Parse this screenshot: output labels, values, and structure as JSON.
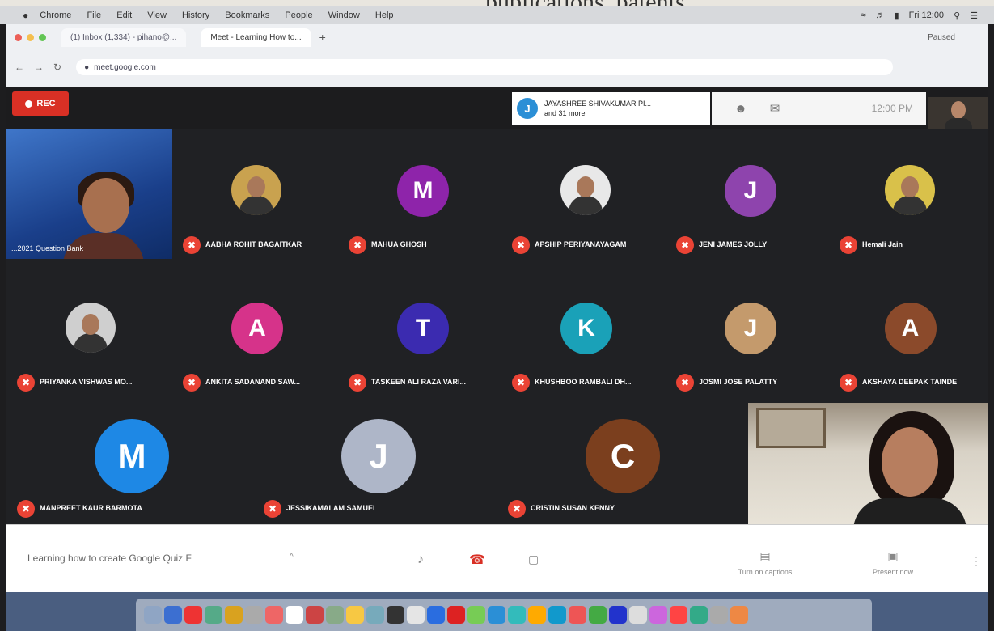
{
  "backdrop_text": "publications, patents",
  "mac_menubar": {
    "items": [
      "Chrome",
      "File",
      "Edit",
      "View",
      "History",
      "Bookmarks",
      "People",
      "Window",
      "Help"
    ],
    "clock": "Fri 12:00"
  },
  "browser": {
    "tabs": [
      "(1) Inbox (1,334) - pihano@...",
      "Meet - Learning How to..."
    ],
    "url": "meet.google.com",
    "profile": "Paused"
  },
  "meet": {
    "rec_label": "REC",
    "presenter": {
      "initial": "J",
      "name": "JAYASHREE SHIVAKUMAR PI...",
      "more": "and 31 more"
    },
    "time": "12:00 PM",
    "video_tile_label": "...2021 Question Bank",
    "participants": [
      {
        "name": "AABHA ROHIT BAGAITKAR",
        "type": "photo",
        "color": "#c9a24f"
      },
      {
        "name": "MAHUA GHOSH",
        "type": "initial",
        "initial": "M",
        "color": "#8e24aa"
      },
      {
        "name": "APSHIP PERIYANAYAGAM",
        "type": "photo",
        "color": "#e8e8e8"
      },
      {
        "name": "JENI JAMES JOLLY",
        "type": "initial",
        "initial": "J",
        "color": "#8e44ad"
      },
      {
        "name": "Hemali Jain",
        "type": "photo",
        "color": "#d9c14a"
      },
      {
        "name": "PRIYANKA VISHWAS MO...",
        "type": "photo",
        "color": "#cfcfcf"
      },
      {
        "name": "ANKITA SADANAND SAW...",
        "type": "initial",
        "initial": "A",
        "color": "#d6338a"
      },
      {
        "name": "TASKEEN ALI RAZA VARI...",
        "type": "initial",
        "initial": "T",
        "color": "#3b2bb0"
      },
      {
        "name": "KHUSHBOO RAMBALI DH...",
        "type": "initial",
        "initial": "K",
        "color": "#1aa1b8"
      },
      {
        "name": "JOSMI JOSE PALATTY",
        "type": "initial",
        "initial": "J",
        "color": "#c49a6c"
      },
      {
        "name": "AKSHAYA DEEPAK TAINDE",
        "type": "initial",
        "initial": "A",
        "color": "#8b4a2b"
      },
      {
        "name": "MANPREET KAUR BARMOTA",
        "type": "initial",
        "initial": "M",
        "color": "#1e88e5"
      },
      {
        "name": "JESSIKAMALAM SAMUEL",
        "type": "initial",
        "initial": "J",
        "color": "#aeb6c8"
      },
      {
        "name": "CRISTIN SUSAN KENNY",
        "type": "initial",
        "initial": "C",
        "color": "#7b3f1e"
      }
    ],
    "meeting_title": "Learning how to create Google Quiz F",
    "turn_on_captions": "Turn on captions",
    "present_now": "Present now"
  },
  "icons": {
    "mic": "mic-icon",
    "end_call": "phone-hangup-icon",
    "camera": "camera-icon",
    "captions": "captions-icon",
    "present": "present-icon",
    "more": "more-vert-icon"
  }
}
